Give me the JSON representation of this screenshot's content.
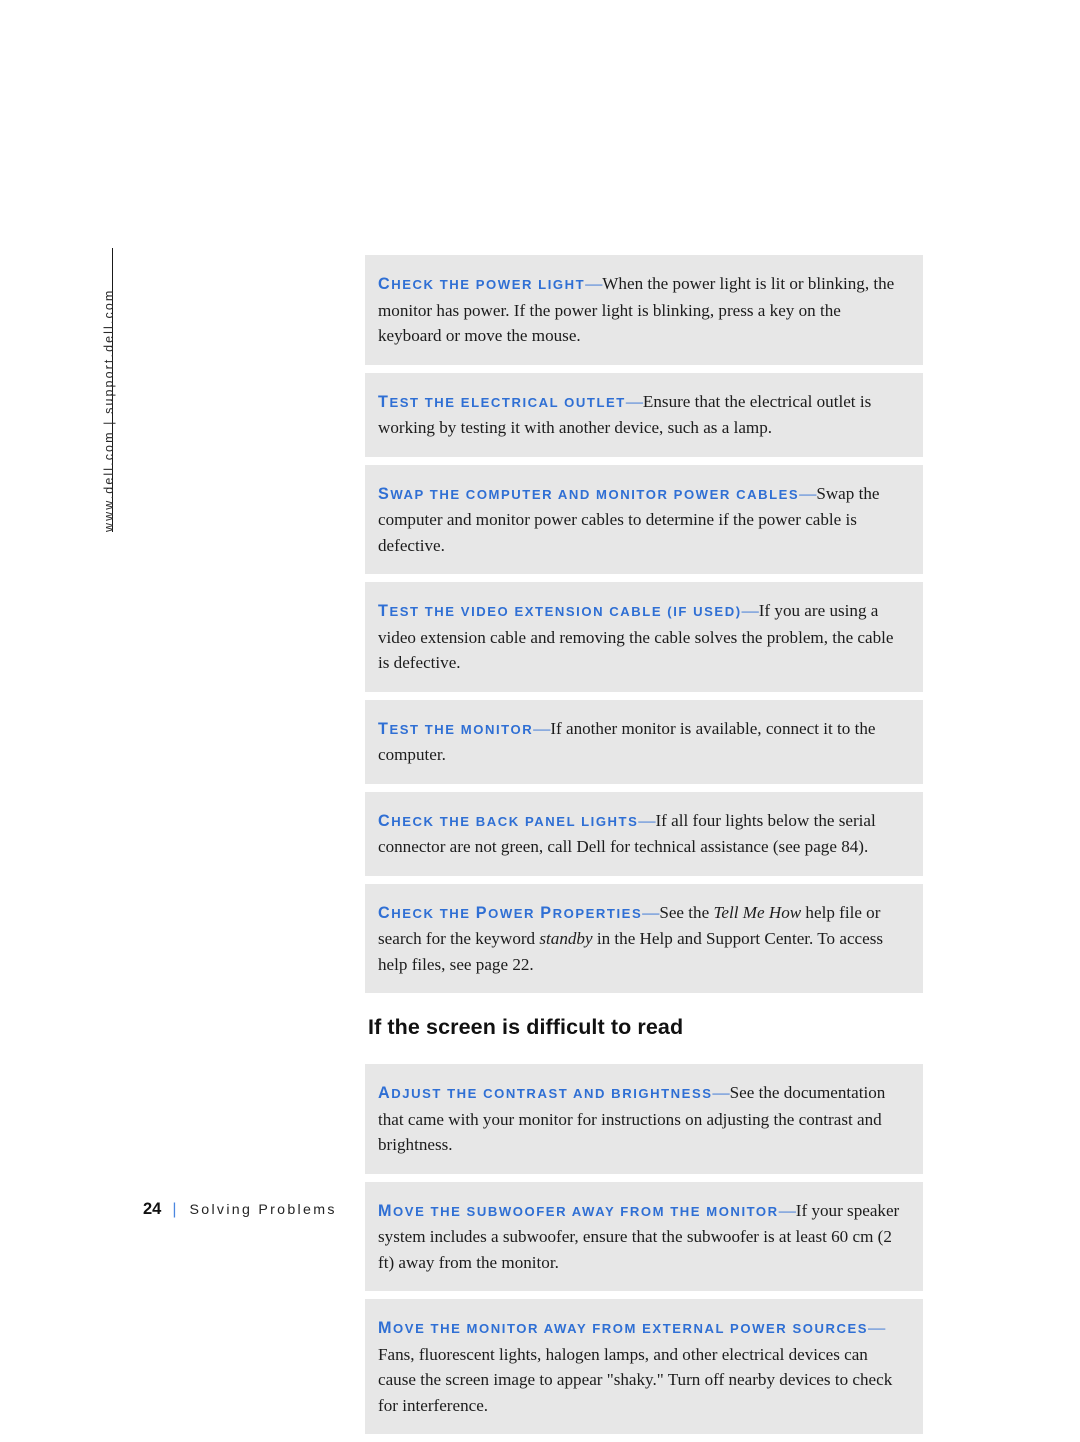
{
  "sidebar": {
    "url_text": "www.dell.com | support.dell.com"
  },
  "footer": {
    "page_number": "24",
    "separator": "|",
    "chapter": "Solving Problems"
  },
  "main": {
    "section_heading": "If the screen is difficult to read",
    "panels_top": [
      {
        "lead_first": "C",
        "lead_rest": "HECK THE POWER LIGHT",
        "dash": "—",
        "body": "When the power light is lit or blinking, the monitor has power. If the power light is blinking, press a key on the keyboard or move the mouse."
      },
      {
        "lead_first": "T",
        "lead_rest": "EST THE ELECTRICAL OUTLET",
        "dash": "—",
        "body": "Ensure that the electrical outlet is working by testing it with another device, such as a lamp."
      },
      {
        "lead_first": "S",
        "lead_rest": "WAP THE COMPUTER AND MONITOR POWER CABLES",
        "dash": "—",
        "body": "Swap the computer and monitor power cables to determine if the power cable is defective."
      },
      {
        "lead_first": "T",
        "lead_rest": "EST THE VIDEO EXTENSION CABLE (IF USED)",
        "dash": "—",
        "body": "If you are using a video extension cable and removing the cable solves the problem, the cable is defective."
      },
      {
        "lead_first": "T",
        "lead_rest": "EST THE MONITOR",
        "dash": "—",
        "body": "If another monitor is available, connect it to the computer."
      },
      {
        "lead_first": "C",
        "lead_rest": "HECK THE BACK PANEL LIGHTS",
        "dash": "—",
        "body": "If all four lights below the serial connector are not green, call Dell for technical assistance (see page 84)."
      },
      {
        "lead_first": "C",
        "lead_rest": "HECK THE ",
        "lead_first2": "P",
        "lead_rest2": "OWER ",
        "lead_first3": "P",
        "lead_rest3": "ROPERTIES",
        "dash": "—",
        "body_part1": "See the ",
        "body_italic1": "Tell Me How",
        "body_part2": " help file or search for the keyword ",
        "body_italic2": "standby",
        "body_part3": " in the Help and Support Center. To access help files, see page 22."
      }
    ],
    "panels_bottom": [
      {
        "lead_first": "A",
        "lead_rest": "DJUST THE CONTRAST AND BRIGHTNESS",
        "dash": "—",
        "body": "See the documentation that came with your monitor for instructions on adjusting the contrast and brightness."
      },
      {
        "lead_first": "M",
        "lead_rest": "OVE THE SUBWOOFER AWAY FROM THE MONITOR",
        "dash": "—",
        "body": "If your speaker system includes a subwoofer, ensure that the subwoofer is at least 60 cm (2 ft) away from the monitor."
      },
      {
        "lead_first": "M",
        "lead_rest": "OVE THE MONITOR AWAY FROM EXTERNAL POWER SOURCES",
        "dash": "—",
        "body": "Fans, fluorescent lights, halogen lamps, and other electrical devices can cause the screen image to appear \"shaky.\" Turn off nearby devices to check for interference."
      }
    ]
  },
  "colors": {
    "lead_blue": "#2f6fd4",
    "panel_gray": "#e7e7e7",
    "body_text": "#1c1c1c"
  }
}
